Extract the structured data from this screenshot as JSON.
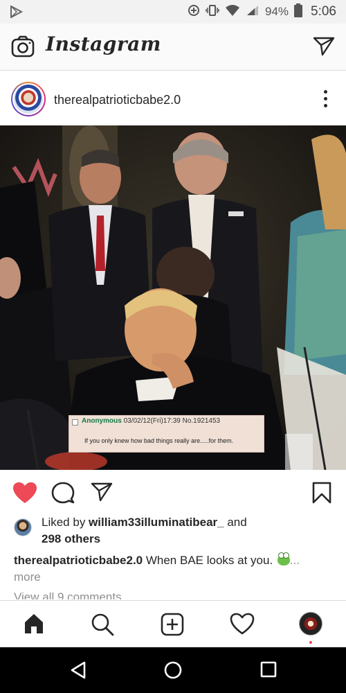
{
  "status_bar": {
    "battery_percent": "94%",
    "time": "5:06"
  },
  "header": {
    "logo_text": "Instagram",
    "icons": [
      "camera-icon",
      "direct-message-icon"
    ]
  },
  "post": {
    "username": "therealpatrioticbabe2.0",
    "overlay": {
      "poster": "Anonymous",
      "meta": "03/02/12(Fri)17:39 No.1921453",
      "text": "If you only knew how bad things really are.....for them."
    },
    "likes": {
      "prefix": "Liked by ",
      "first_liker": "william33illuminatibear_",
      "and": " and",
      "others": "298 others"
    },
    "caption": {
      "username": "therealpatrioticbabe2.0",
      "text": " When BAE looks at you. ",
      "ellipsis": "...",
      "more": "more"
    },
    "view_comments": "View all 9 comments",
    "liked": true
  },
  "colors": {
    "like_red": "#ed4956",
    "text": "#262626",
    "secondary": "#8e8e8e"
  },
  "bottom_nav": [
    "home-icon",
    "search-icon",
    "new-post-icon",
    "activity-icon",
    "profile-avatar"
  ],
  "system_nav": [
    "back-icon",
    "home-circle-icon",
    "recents-icon"
  ]
}
